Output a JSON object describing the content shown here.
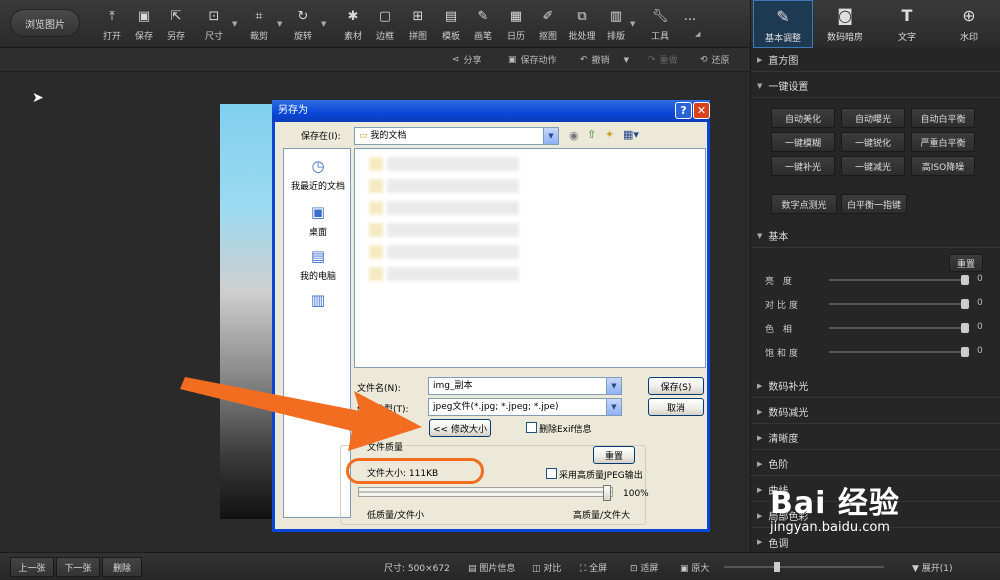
{
  "toolbar": {
    "browse_label": "浏览图片",
    "tools": [
      {
        "label": "打开",
        "icon": "open-icon"
      },
      {
        "label": "保存",
        "icon": "save-icon"
      },
      {
        "label": "另存",
        "icon": "save-as-icon"
      },
      {
        "label": "尺寸",
        "icon": "resize-icon"
      },
      {
        "label": "裁剪",
        "icon": "crop-icon"
      },
      {
        "label": "旋转",
        "icon": "rotate-icon"
      },
      {
        "label": "素材",
        "icon": "material-icon"
      },
      {
        "label": "边框",
        "icon": "border-icon"
      },
      {
        "label": "拼图",
        "icon": "collage-icon"
      },
      {
        "label": "模板",
        "icon": "template-icon"
      },
      {
        "label": "画笔",
        "icon": "brush-icon"
      },
      {
        "label": "日历",
        "icon": "calendar-icon"
      },
      {
        "label": "抠图",
        "icon": "cutout-icon"
      },
      {
        "label": "批处理",
        "icon": "batch-icon"
      },
      {
        "label": "排版",
        "icon": "layout-icon"
      },
      {
        "label": "工具",
        "icon": "wrench-icon"
      },
      {
        "label": "...",
        "icon": "more-icon"
      }
    ]
  },
  "right_tabs": [
    {
      "label": "基本调整",
      "icon": "adjust-icon",
      "active": true
    },
    {
      "label": "数码暗房",
      "icon": "camera-icon",
      "active": false
    },
    {
      "label": "文字",
      "icon": "text-icon",
      "active": false
    },
    {
      "label": "水印",
      "icon": "watermark-icon",
      "active": false
    }
  ],
  "subbar": {
    "share": "分享",
    "save_action": "保存动作",
    "undo": "撤销",
    "redo": "重做",
    "restore": "还原"
  },
  "dialog": {
    "title": "另存为",
    "help": "?",
    "close": "✕",
    "save_in_label": "保存在(I):",
    "save_in_value": "我的文档",
    "places": [
      "我最近的文档",
      "桌面",
      "我的电脑",
      ""
    ],
    "filename_label": "文件名(N):",
    "filename_value": "img_副本",
    "filetype_label": "保存类型(T):",
    "filetype_value": "jpeg文件(*.jpg; *.jpeg; *.jpe)",
    "save_button": "保存(S)",
    "cancel_button": "取消",
    "resize_button": "<< 修改大小",
    "remove_exif_label": "删除Exif信息",
    "quality_group": "文件质量",
    "reset_button": "重置",
    "file_size": "文件大小: 111KB",
    "hq_jpeg_label": "采用高质量JPEG输出",
    "quality_percent": "100%",
    "quality_value": 1.0,
    "low_label": "低质量/文件小",
    "high_label": "高质量/文件大"
  },
  "panel": {
    "histogram": "直方图",
    "one_click": "一键设置",
    "one_click_buttons": [
      "自动美化",
      "自动曝光",
      "自动白平衡",
      "一键模糊",
      "一键锐化",
      "严重白平衡",
      "一键补光",
      "一键减光",
      "高ISO降噪"
    ],
    "extra_buttons": [
      "数字点测光",
      "白平衡一指键"
    ],
    "basic": "基本",
    "reset": "重置",
    "sliders": [
      {
        "label": "亮 度",
        "value": "0"
      },
      {
        "label": "对比度",
        "value": "0"
      },
      {
        "label": "色 相",
        "value": "0"
      },
      {
        "label": "饱和度",
        "value": "0"
      }
    ],
    "sections": [
      "数码补光",
      "数码减光",
      "清晰度",
      "色阶",
      "曲线",
      "局部色彩",
      "色调"
    ]
  },
  "bottom": {
    "prev": "上一张",
    "next": "下一张",
    "delete": "删除",
    "size": "尺寸: 500×672",
    "info": "图片信息",
    "compare": "对比",
    "fullscreen": "全屏",
    "fit": "适屏",
    "original": "原大",
    "expand": "展开(1)"
  },
  "watermark": {
    "logo": "Bai 经验",
    "url": "jingyan.baidu.com"
  },
  "colors": {
    "accent": "#0a46d8",
    "highlight": "#f36d21"
  }
}
